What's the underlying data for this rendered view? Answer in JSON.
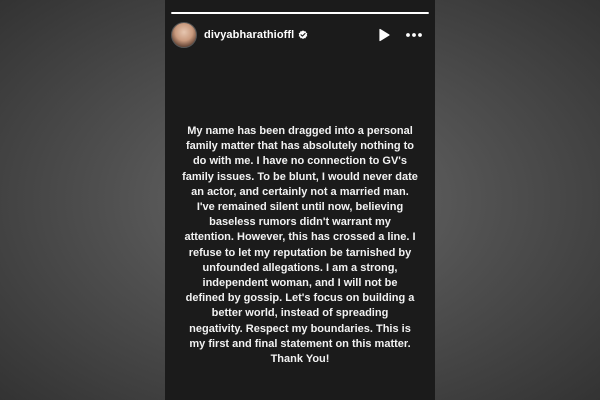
{
  "story": {
    "username": "divyabharathioffl",
    "progress_fraction": 1.0,
    "verified_icon": "verified-badge-icon",
    "play_icon": "play-icon",
    "more_icon": "more-options-icon",
    "message": "My name has been dragged into a personal\nfamily matter that has absolutely nothing to\ndo with me. I have no connection to GV's\nfamily issues. To be blunt, I would never date\nan actor, and certainly not a married man.\nI've remained silent until now, believing\nbaseless rumors didn't warrant my\nattention. However, this has crossed a line. I\nrefuse to let my reputation be tarnished by\nunfounded allegations. I am a strong,\nindependent woman, and I will not be\ndefined by gossip. Let's focus on building a\nbetter world, instead of spreading\nnegativity. Respect my boundaries. This is\nmy first and final statement on this matter.\nThank You!"
  },
  "colors": {
    "story_background": "#1b1b1b",
    "text": "#f2f2f2",
    "outer_background": "#505050"
  }
}
